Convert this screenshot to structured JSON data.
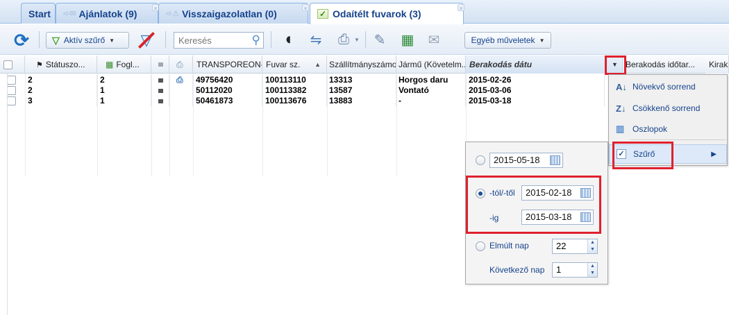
{
  "tabs": [
    {
      "label": "Start"
    },
    {
      "label": "Ajánlatok (9)"
    },
    {
      "label": "Visszaigazolatlan (0)"
    },
    {
      "label": "Odaítélt fuvarok (3)"
    }
  ],
  "toolbar": {
    "filter_label": "Aktív szűrő",
    "search_placeholder": "Keresés",
    "other_label": "Egyéb műveletek"
  },
  "grid": {
    "columns": [
      "Státuszo...",
      "Fogl...",
      "TRANSPOREON-ID",
      "Fuvar sz.",
      "Szállítmányszámok",
      "Jármű (Követelm...",
      "Berakodás dátu",
      "Berakodás időtar...",
      "Kirak"
    ],
    "rows": [
      {
        "status": "2",
        "fogl": "2",
        "tid": "49756420",
        "fuvar": "100113110",
        "szall": "13313",
        "jarmu": "Horgos daru",
        "datum": "2015-02-26"
      },
      {
        "status": "2",
        "fogl": "1",
        "tid": "50112020",
        "fuvar": "100113382",
        "szall": "13587",
        "jarmu": "Vontató",
        "datum": "2015-03-06"
      },
      {
        "status": "3",
        "fogl": "1",
        "tid": "50461873",
        "fuvar": "100113676",
        "szall": "13883",
        "jarmu": "-",
        "datum": "2015-03-18"
      }
    ]
  },
  "menu": {
    "items": [
      "Növekvő sorrend",
      "Csökkenő sorrend",
      "Oszlopok",
      "Szűrő"
    ]
  },
  "filter": {
    "date_single": "2015-05-18",
    "from_label": "-tól/-től",
    "from_value": "2015-02-18",
    "to_label": "-ig",
    "to_value": "2015-03-18",
    "past_label": "Elmúlt nap",
    "past_value": "22",
    "next_label": "Következő nap",
    "next_value": "1"
  },
  "colors": {
    "accent": "#15428b",
    "highlight": "#e0202e"
  }
}
